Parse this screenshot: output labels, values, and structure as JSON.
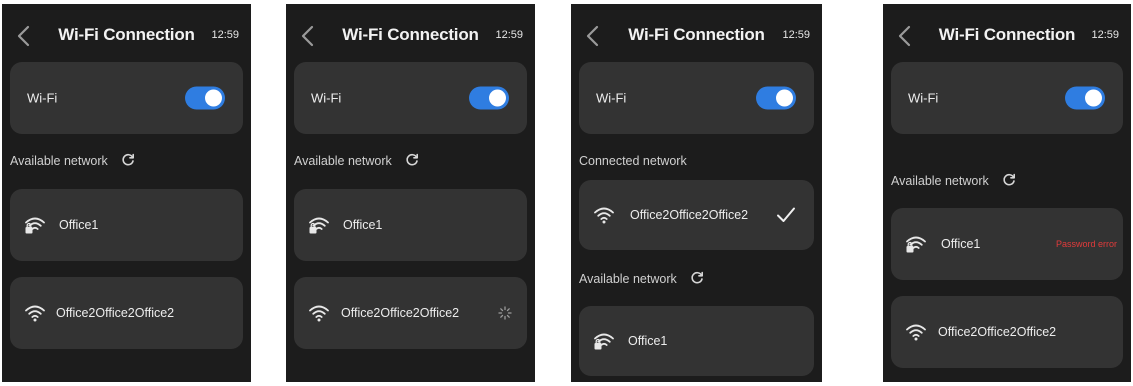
{
  "screens": [
    {
      "header": {
        "title": "Wi-Fi Connection",
        "time": "12:59"
      },
      "wifi_label": "Wi-Fi",
      "wifi_enabled": true,
      "available_label": "Available network",
      "networks": [
        {
          "name": "Office1",
          "icon": "locked-wifi-icon"
        },
        {
          "name": "Office2Office2Office2",
          "icon": "wifi-icon"
        }
      ]
    },
    {
      "header": {
        "title": "Wi-Fi Connection",
        "time": "12:59"
      },
      "wifi_label": "Wi-Fi",
      "wifi_enabled": true,
      "available_label": "Available network",
      "networks": [
        {
          "name": "Office1",
          "icon": "locked-wifi-icon"
        },
        {
          "name": "Office2Office2Office2",
          "icon": "wifi-icon",
          "status": "connecting-spinner-icon"
        }
      ]
    },
    {
      "header": {
        "title": "Wi-Fi Connection",
        "time": "12:59"
      },
      "wifi_label": "Wi-Fi",
      "wifi_enabled": true,
      "connected_label": "Connected network",
      "connected_network": {
        "name": "Office2Office2Office2",
        "icon": "wifi-icon",
        "status": "checkmark-icon"
      },
      "available_label": "Available network",
      "networks": [
        {
          "name": "Office1",
          "icon": "locked-wifi-icon"
        }
      ]
    },
    {
      "header": {
        "title": "Wi-Fi Connection",
        "time": "12:59"
      },
      "wifi_label": "Wi-Fi",
      "wifi_enabled": true,
      "available_label": "Available network",
      "networks": [
        {
          "name": "Office1",
          "icon": "locked-wifi-icon",
          "error": "Password error"
        },
        {
          "name": "Office2Office2Office2",
          "icon": "wifi-icon"
        }
      ]
    }
  ],
  "colors": {
    "background": "#1c1c1c",
    "card": "#333333",
    "toggle_on": "#2f7de1",
    "error": "#e23b3b"
  }
}
